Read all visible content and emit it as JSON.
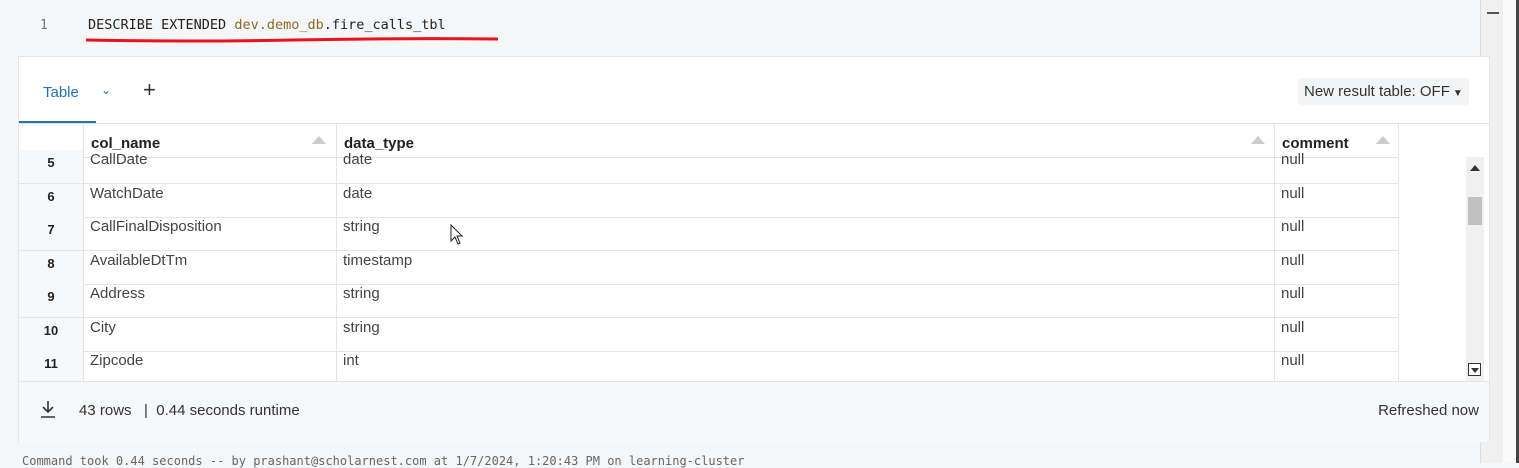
{
  "editor": {
    "line_number": "1",
    "code_keyword": "DESCRIBE EXTENDED ",
    "code_schema": "dev.demo_db",
    "code_table": ".fire_calls_tbl"
  },
  "results": {
    "tab_label": "Table",
    "add_tab": "+",
    "new_result_toggle": "New result table: OFF",
    "columns": [
      "col_name",
      "data_type",
      "comment"
    ],
    "rows": [
      {
        "n": "5",
        "col_name": "CallDate",
        "data_type": "date",
        "comment": "null"
      },
      {
        "n": "6",
        "col_name": "WatchDate",
        "data_type": "date",
        "comment": "null"
      },
      {
        "n": "7",
        "col_name": "CallFinalDisposition",
        "data_type": "string",
        "comment": "null"
      },
      {
        "n": "8",
        "col_name": "AvailableDtTm",
        "data_type": "timestamp",
        "comment": "null"
      },
      {
        "n": "9",
        "col_name": "Address",
        "data_type": "string",
        "comment": "null"
      },
      {
        "n": "10",
        "col_name": "City",
        "data_type": "string",
        "comment": "null"
      },
      {
        "n": "11",
        "col_name": "Zipcode",
        "data_type": "int",
        "comment": "null"
      }
    ],
    "footer_rows": "43 rows",
    "footer_runtime": "0.44 seconds runtime",
    "refreshed": "Refreshed now"
  },
  "status_line": "Command took 0.44 seconds -- by prashant@scholarnest.com at 1/7/2024, 1:20:43 PM on learning-cluster",
  "colors": {
    "accent": "#2272b4",
    "underline_mark": "#e8141b"
  }
}
